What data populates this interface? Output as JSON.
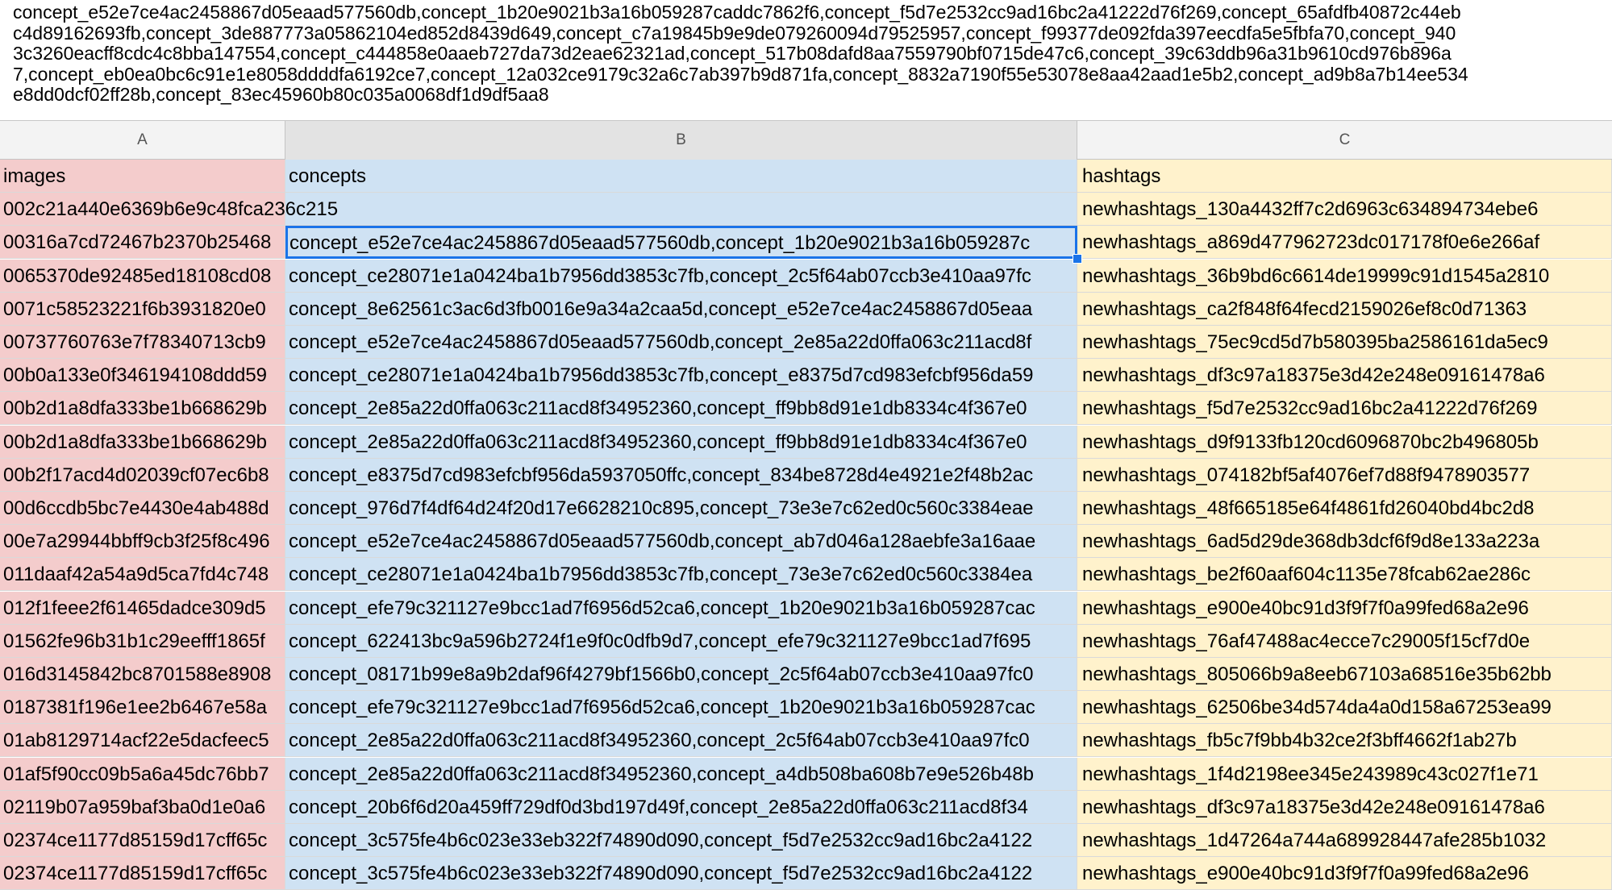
{
  "formula_bar": {
    "lines": [
      "concept_e52e7ce4ac2458867d05eaad577560db,concept_1b20e9021b3a16b059287caddc7862f6,concept_f5d7e2532cc9ad16bc2a41222d76f269,concept_65afdfb40872c44eb",
      "c4d89162693fb,concept_3de887773a05862104ed852d8439d649,concept_c7a19845b9e9de079260094d79525957,concept_f99377de092fda397eecdfa5e5fbfa70,concept_940",
      "3c3260eacff8cdc4c8bba147554,concept_c444858e0aaeb727da73d2eae62321ad,concept_517b08dafd8aa7559790bf0715de47c6,concept_39c63ddb96a31b9610cd976b896a",
      "7,concept_eb0ea0bc6c91e1e8058ddddfa6192ce7,concept_12a032ce9179c32a6c7ab397b9d871fa,concept_8832a7190f55e53078e8aa42aad1e5b2,concept_ad9b8a7b14ee534",
      "e8dd0dcf02ff28b,concept_83ec45960b80c035a0068df1d9df5aa8"
    ]
  },
  "columns": [
    {
      "letter": "A"
    },
    {
      "letter": "B"
    },
    {
      "letter": "C"
    }
  ],
  "rows": [
    [
      "images",
      "concepts",
      "hashtags"
    ],
    [
      "002c21a440e6369b6e9c48fca236c215",
      "",
      "newhashtags_130a4432ff7c2d6963c634894734ebe6"
    ],
    [
      "00316a7cd72467b2370b25468",
      "concept_e52e7ce4ac2458867d05eaad577560db,concept_1b20e9021b3a16b059287c",
      "newhashtags_a869d477962723dc017178f0e6e266af"
    ],
    [
      "0065370de92485ed18108cd08",
      "concept_ce28071e1a0424ba1b7956dd3853c7fb,concept_2c5f64ab07ccb3e410aa97fc",
      "newhashtags_36b9bd6c6614de19999c91d1545a2810"
    ],
    [
      "0071c58523221f6b3931820e0",
      "concept_8e62561c3ac6d3fb0016e9a34a2caa5d,concept_e52e7ce4ac2458867d05eaa",
      "newhashtags_ca2f848f64fecd2159026ef8c0d71363"
    ],
    [
      "00737760763e7f78340713cb9",
      "concept_e52e7ce4ac2458867d05eaad577560db,concept_2e85a22d0ffa063c211acd8f",
      "newhashtags_75ec9cd5d7b580395ba2586161da5ec9"
    ],
    [
      "00b0a133e0f346194108ddd59",
      "concept_ce28071e1a0424ba1b7956dd3853c7fb,concept_e8375d7cd983efcbf956da59",
      "newhashtags_df3c97a18375e3d42e248e09161478a6"
    ],
    [
      "00b2d1a8dfa333be1b668629b",
      "concept_2e85a22d0ffa063c211acd8f34952360,concept_ff9bb8d91e1db8334c4f367e0",
      "newhashtags_f5d7e2532cc9ad16bc2a41222d76f269"
    ],
    [
      "00b2d1a8dfa333be1b668629b",
      "concept_2e85a22d0ffa063c211acd8f34952360,concept_ff9bb8d91e1db8334c4f367e0",
      "newhashtags_d9f9133fb120cd6096870bc2b496805b"
    ],
    [
      "00b2f17acd4d02039cf07ec6b8",
      "concept_e8375d7cd983efcbf956da5937050ffc,concept_834be8728d4e4921e2f48b2ac",
      "newhashtags_074182bf5af4076ef7d88f9478903577"
    ],
    [
      "00d6ccdb5bc7e4430e4ab488d",
      "concept_976d7f4df64d24f20d17e6628210c895,concept_73e3e7c62ed0c560c3384eae",
      "newhashtags_48f665185e64f4861fd26040bd4bc2d8"
    ],
    [
      "00e7a29944bbff9cb3f25f8c496",
      "concept_e52e7ce4ac2458867d05eaad577560db,concept_ab7d046a128aebfe3a16aae",
      "newhashtags_6ad5d29de368db3dcf6f9d8e133a223a"
    ],
    [
      "011daaf42a54a9d5ca7fd4c748",
      "concept_ce28071e1a0424ba1b7956dd3853c7fb,concept_73e3e7c62ed0c560c3384ea",
      "newhashtags_be2f60aaf604c1135e78fcab62ae286c"
    ],
    [
      "012f1feee2f61465dadce309d5",
      "concept_efe79c321127e9bcc1ad7f6956d52ca6,concept_1b20e9021b3a16b059287cac",
      "newhashtags_e900e40bc91d3f9f7f0a99fed68a2e96"
    ],
    [
      "01562fe96b31b1c29eefff1865f",
      "concept_622413bc9a596b2724f1e9f0c0dfb9d7,concept_efe79c321127e9bcc1ad7f695",
      "newhashtags_76af47488ac4ecce7c29005f15cf7d0e"
    ],
    [
      "016d3145842bc8701588e8908",
      "concept_08171b99e8a9b2daf96f4279bf1566b0,concept_2c5f64ab07ccb3e410aa97fc0",
      "newhashtags_805066b9a8eeb67103a68516e35b62bb"
    ],
    [
      "0187381f196e1ee2b6467e58a",
      "concept_efe79c321127e9bcc1ad7f6956d52ca6,concept_1b20e9021b3a16b059287cac",
      "newhashtags_62506be34d574da4a0d158a67253ea99"
    ],
    [
      "01ab8129714acf22e5dacfeec5",
      "concept_2e85a22d0ffa063c211acd8f34952360,concept_2c5f64ab07ccb3e410aa97fc0",
      "newhashtags_fb5c7f9bb4b32ce2f3bff4662f1ab27b"
    ],
    [
      "01af5f90cc09b5a6a45dc76bb7",
      "concept_2e85a22d0ffa063c211acd8f34952360,concept_a4db508ba608b7e9e526b48b",
      "newhashtags_1f4d2198ee345e243989c43c027f1e71"
    ],
    [
      "02119b07a959baf3ba0d1e0a6",
      "concept_20b6f6d20a459ff729df0d3bd197d49f,concept_2e85a22d0ffa063c211acd8f34",
      "newhashtags_df3c97a18375e3d42e248e09161478a6"
    ],
    [
      "02374ce1177d85159d17cff65c",
      "concept_3c575fe4b6c023e33eb322f74890d090,concept_f5d7e2532cc9ad16bc2a4122",
      "newhashtags_1d47264a744a689928447afe285b1032"
    ],
    [
      "02374ce1177d85159d17cff65c",
      "concept_3c575fe4b6c023e33eb322f74890d090,concept_f5d7e2532cc9ad16bc2a4122",
      "newhashtags_e900e40bc91d3f9f7f0a99fed68a2e96"
    ]
  ],
  "colors": {
    "images_column_fill": "#f4cccc",
    "concepts_column_fill": "#cfe2f3",
    "hashtags_column_fill": "#fff2cc",
    "selection_accent": "#1a73e8"
  }
}
